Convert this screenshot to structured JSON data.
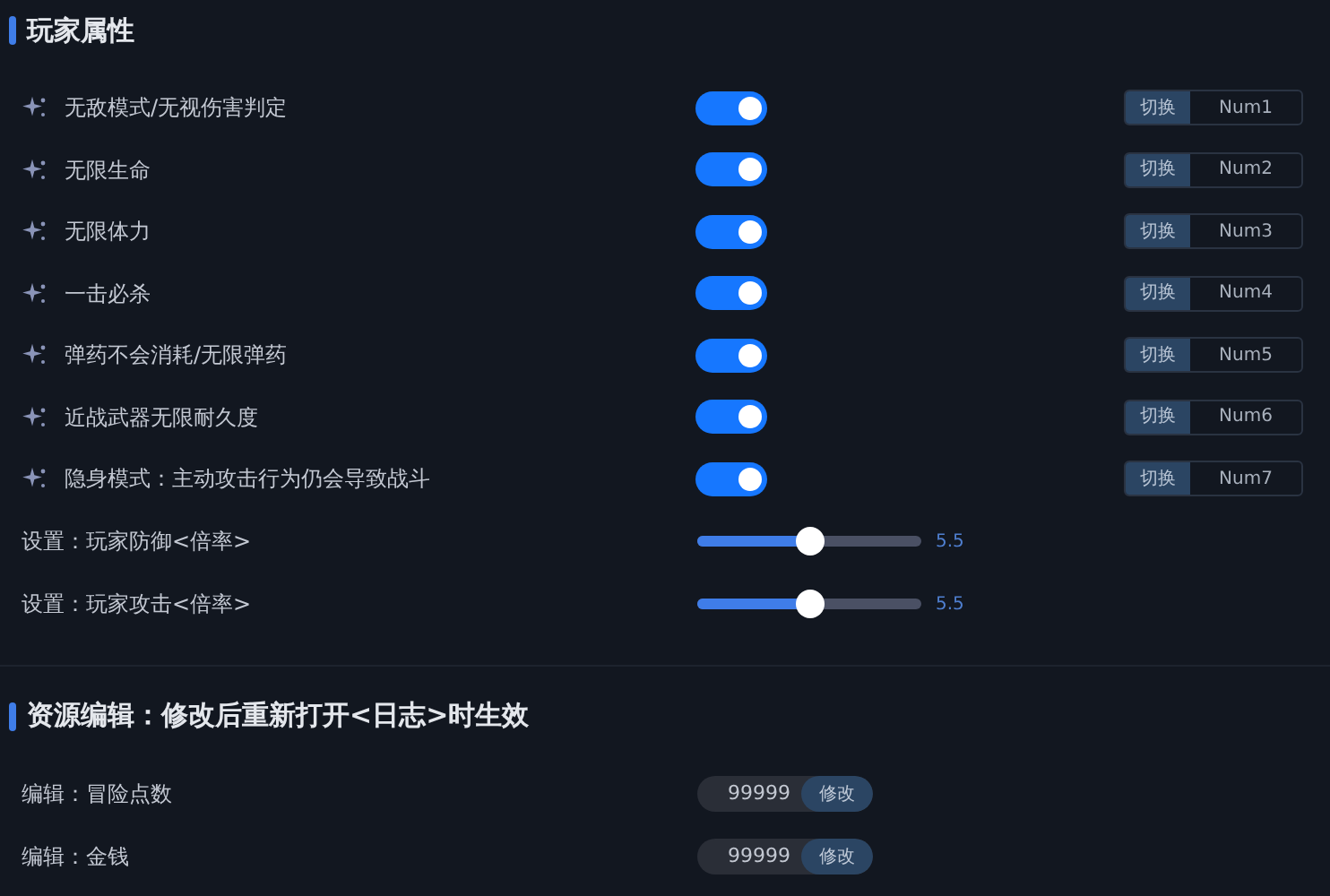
{
  "sections": [
    {
      "title": "玩家属性",
      "rows": [
        {
          "kind": "toggle",
          "label": "无敌模式/无视伤害判定",
          "on": true,
          "hotkey_label": "切换",
          "hotkey": "Num1"
        },
        {
          "kind": "toggle",
          "label": "无限生命",
          "on": true,
          "hotkey_label": "切换",
          "hotkey": "Num2"
        },
        {
          "kind": "toggle",
          "label": "无限体力",
          "on": true,
          "hotkey_label": "切换",
          "hotkey": "Num3"
        },
        {
          "kind": "toggle",
          "label": "一击必杀",
          "on": true,
          "hotkey_label": "切换",
          "hotkey": "Num4"
        },
        {
          "kind": "toggle",
          "label": "弹药不会消耗/无限弹药",
          "on": true,
          "hotkey_label": "切换",
          "hotkey": "Num5"
        },
        {
          "kind": "toggle",
          "label": "近战武器无限耐久度",
          "on": true,
          "hotkey_label": "切换",
          "hotkey": "Num6"
        },
        {
          "kind": "toggle",
          "label": "隐身模式：主动攻击行为仍会导致战斗",
          "on": true,
          "hotkey_label": "切换",
          "hotkey": "Num7"
        },
        {
          "kind": "slider",
          "label": "设置：玩家防御<倍率>",
          "level": 0.5,
          "reading": "5.5"
        },
        {
          "kind": "slider",
          "label": "设置：玩家攻击<倍率>",
          "level": 0.5,
          "reading": "5.5"
        }
      ]
    },
    {
      "title": "资源编辑：修改后重新打开<日志>时生效",
      "rows": [
        {
          "kind": "edit",
          "label": "编辑：冒险点数",
          "value": "99999",
          "button": "修改"
        },
        {
          "kind": "edit",
          "label": "编辑：金钱",
          "value": "99999",
          "button": "修改"
        }
      ]
    }
  ]
}
